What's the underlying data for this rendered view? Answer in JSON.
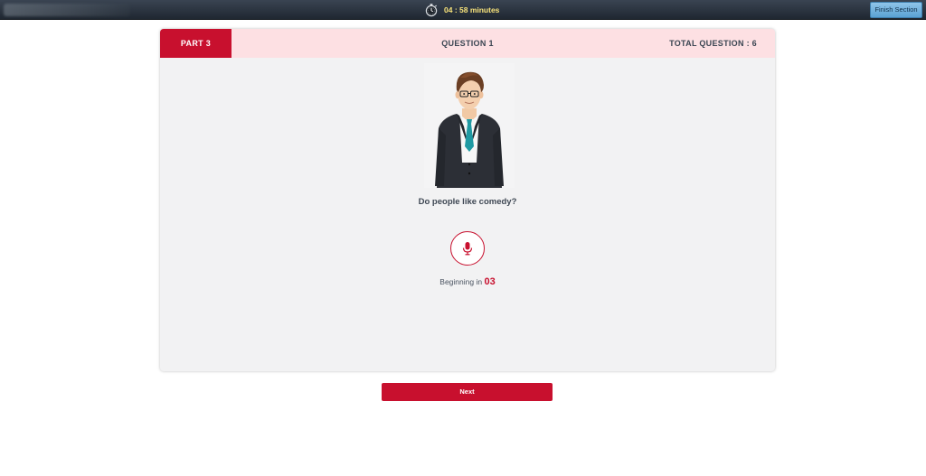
{
  "topbar": {
    "timer_text": "04 : 58 minutes",
    "timer_icon": "stopwatch-icon",
    "finish_label": "Finish Section"
  },
  "card": {
    "part_label": "PART 3",
    "question_label": "QUESTION 1",
    "total_label": "TOTAL QUESTION : 6",
    "question_text": "Do people like comedy?",
    "mic_icon": "microphone-icon",
    "countdown_prefix": "Beginning in",
    "countdown_value": "03"
  },
  "footer": {
    "next_label": "Next"
  },
  "colors": {
    "accent": "#c8102e",
    "header_bg": "#fde0e3",
    "card_bg": "#f2f2f3",
    "topbar_bg": "#2b3440",
    "timer_text": "#f7e27a",
    "finish_button": "#6fb0dc"
  }
}
